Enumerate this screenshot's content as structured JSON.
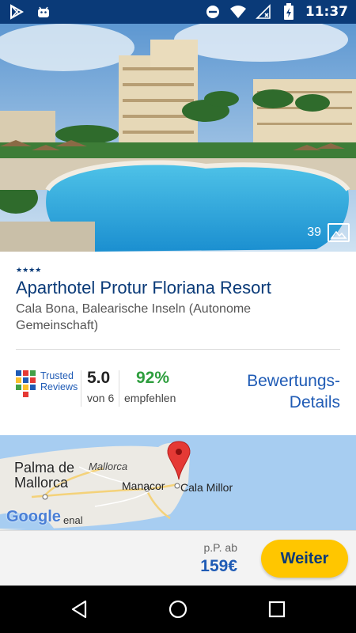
{
  "status_bar": {
    "time": "11:37",
    "icons": [
      "dnd-icon",
      "wifi-icon",
      "no-signal-icon",
      "battery-icon"
    ],
    "app_icons": [
      "play-store-icon",
      "android-icon"
    ]
  },
  "hero": {
    "photo_count": "39",
    "gallery_icon": "gallery-icon"
  },
  "hotel": {
    "stars": "★★★★",
    "name": "Aparthotel Protur Floriana Resort",
    "location": "Cala Bona, Balearische Inseln (Autonome Gemeinschaft)"
  },
  "reviews": {
    "provider_line1": "Trusted",
    "provider_line2": "Reviews",
    "score": "5.0",
    "score_of": "von 6",
    "recommend_percent": "92%",
    "recommend_label": "empfehlen",
    "details_link_line1": "Bewertungs-",
    "details_link_line2": "Details"
  },
  "map": {
    "labels": {
      "palma_line1": "Palma de",
      "palma_line2": "Mallorca",
      "mallorca": "Mallorca",
      "manacor": "Manacor",
      "cala_millor": "Cala Millor",
      "google": "Google",
      "enal": "enal"
    }
  },
  "booking": {
    "price_label": "p.P. ab",
    "price": "159€",
    "cta_label": "Weiter"
  },
  "nav": {
    "buttons": [
      "back-icon",
      "home-icon",
      "recents-icon"
    ]
  },
  "colors": {
    "brand_blue": "#0a3a78",
    "link_blue": "#1f5bb5",
    "cta_yellow": "#ffc600",
    "recommend_green": "#2e9e3e"
  }
}
